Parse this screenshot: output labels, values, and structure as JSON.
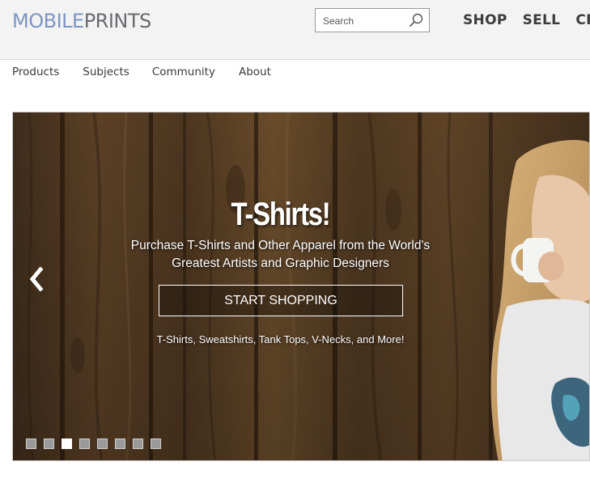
{
  "logo": {
    "part1": "MOBILE",
    "part2": "PRINTS"
  },
  "search": {
    "placeholder": "Search",
    "value": ""
  },
  "topnav": {
    "shop": "SHOP",
    "sell": "SELL",
    "create": "CR"
  },
  "subnav": {
    "products": "Products",
    "subjects": "Subjects",
    "community": "Community",
    "about": "About"
  },
  "hero": {
    "title": "T-Shirts!",
    "subtitle_line1": "Purchase T-Shirts and Other Apparel from the World's",
    "subtitle_line2": "Greatest Artists and Graphic Designers",
    "cta": "START SHOPPING",
    "note": "T-Shirts, Sweatshirts, Tank Tops, V-Necks, and More!",
    "slide_count": 8,
    "active_slide": 3
  },
  "icons": {
    "search": "search-icon",
    "prev": "chevron-left-icon"
  },
  "colors": {
    "logo_light": "#7b95c4",
    "logo_dark": "#6a6a72",
    "nav_text": "#3c3c3c",
    "header_bg": "#f3f3f3"
  }
}
